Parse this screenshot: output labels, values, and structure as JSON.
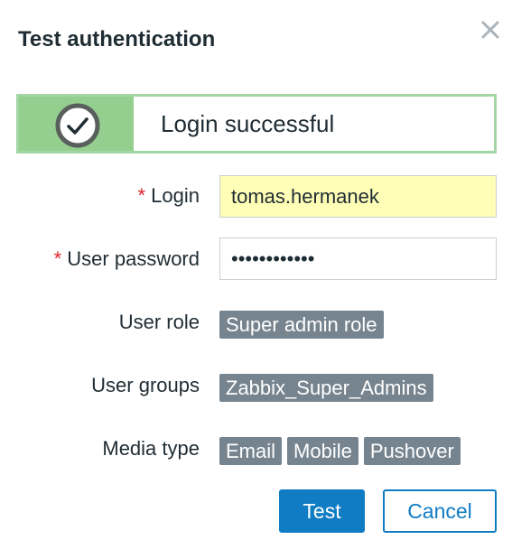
{
  "dialog": {
    "title": "Test authentication",
    "close_icon": "close-icon"
  },
  "message": {
    "icon": "check-circle-icon",
    "text": "Login successful",
    "colors": {
      "icon_bg": "#94cf8f",
      "border": "#a2d6a5"
    }
  },
  "form": {
    "required_marker": "*",
    "login": {
      "label": "Login",
      "value": "tomas.hermanek",
      "required": true
    },
    "password": {
      "label": "User password",
      "value": "••••••••••••",
      "required": true
    },
    "user_role": {
      "label": "User role",
      "tags": [
        "Super admin role"
      ]
    },
    "user_groups": {
      "label": "User groups",
      "tags": [
        "Zabbix_Super_Admins"
      ]
    },
    "media_type": {
      "label": "Media type",
      "tags": [
        "Email",
        "Mobile",
        "Pushover"
      ]
    }
  },
  "buttons": {
    "test": "Test",
    "cancel": "Cancel"
  },
  "colors": {
    "primary": "#0f7cc3",
    "tag_bg": "#76848f",
    "required": "#e0232b",
    "login_bg": "#fefeb6"
  }
}
